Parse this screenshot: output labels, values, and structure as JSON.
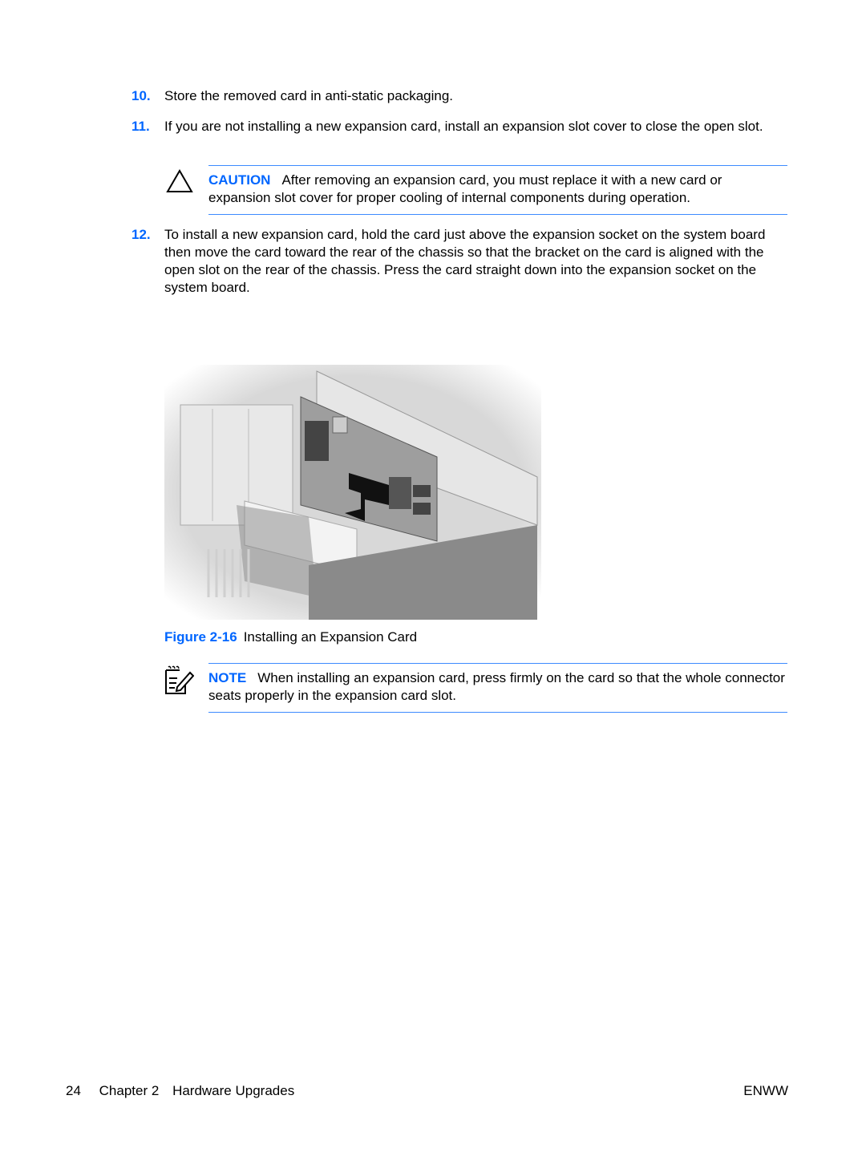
{
  "steps": [
    {
      "num": "10.",
      "text": "Store the removed card in anti-static packaging."
    },
    {
      "num": "11.",
      "text": "If you are not installing a new expansion card, install an expansion slot cover to close the open slot."
    },
    {
      "num": "12.",
      "text": "To install a new expansion card, hold the card just above the expansion socket on the system board then move the card toward the rear of the chassis so that the bracket on the card is aligned with the open slot on the rear of the chassis. Press the card straight down into the expansion socket on the system board."
    }
  ],
  "caution": {
    "icon": "warning-triangle-icon",
    "label": "CAUTION",
    "text": "After removing an expansion card, you must replace it with a new card or expansion slot cover for proper cooling of internal components during operation."
  },
  "figure": {
    "label": "Figure 2-16",
    "caption": "Installing an Expansion Card",
    "alt": "Illustration of expansion card being inserted into chassis slot"
  },
  "note": {
    "icon": "note-pencil-icon",
    "label": "NOTE",
    "text": "When installing an expansion card, press firmly on the card so that the whole connector seats properly in the expansion card slot."
  },
  "footer": {
    "page_number": "24",
    "chapter": "Chapter 2",
    "chapter_title": "Hardware Upgrades",
    "locale": "ENWW"
  },
  "colors": {
    "accent": "#0066ff",
    "rule": "#3d8bff"
  }
}
